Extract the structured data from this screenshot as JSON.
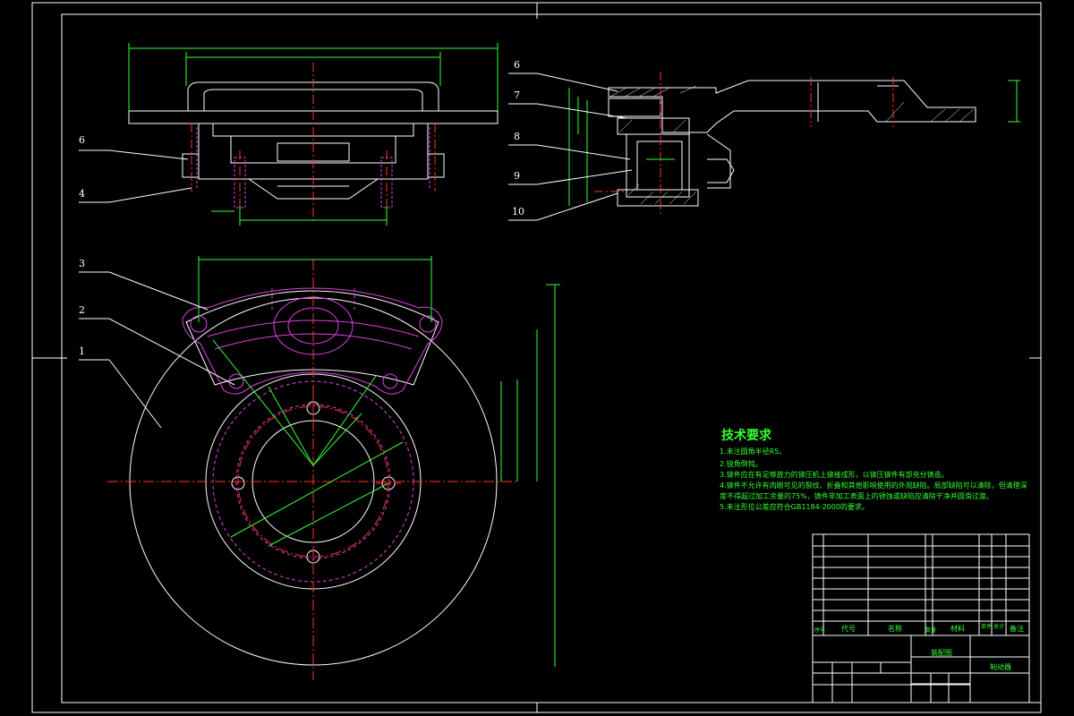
{
  "colors": {
    "background": "#000000",
    "outline": "#ffffff",
    "centerline": "#ff3030",
    "hidden": "#e040e0",
    "dimension": "#33ff33"
  },
  "callouts": {
    "front": [
      "6",
      "4"
    ],
    "section": [
      "6",
      "7",
      "8",
      "9",
      "10"
    ],
    "plan": [
      "3",
      "2",
      "1"
    ]
  },
  "tech": {
    "title": "技术要求",
    "lines": [
      "1.未注圆角半径R5。",
      "2.锐角倒钝。",
      "3.铆件应在有足够放力的铆压机上铆接成形，以铆压铆件有部充分铸造。",
      "4.铆件不允许有肉眼可见的裂纹、折叠和其他影响使用的外观缺陷。局部缺陷可以清除，但清理深",
      "度不得超过加工余量的75%，铸件非加工表面上的锈蚀或缺陷应清除干净并圆滑过渡。",
      "5.未注形位公差应符合GB1184-2000的要求。"
    ]
  },
  "title_block": {
    "headers": [
      "序号",
      "代号",
      "名称",
      "数量",
      "材料",
      "单件",
      "总计",
      "备注"
    ],
    "drawing_name": "制动器",
    "assembly_label": "装配图"
  }
}
